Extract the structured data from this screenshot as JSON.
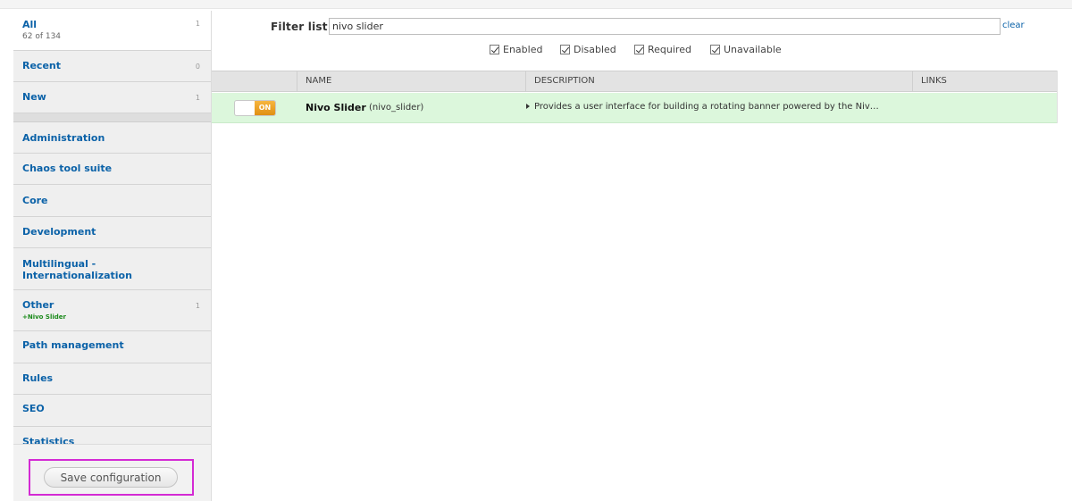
{
  "sidebar": {
    "categories": [
      {
        "label": "All",
        "count": "1",
        "sub": "62 of 134"
      },
      {
        "label": "Recent",
        "count": "0"
      },
      {
        "label": "New",
        "count": "1"
      },
      {
        "label": "Administration"
      },
      {
        "label": "Chaos tool suite"
      },
      {
        "label": "Core"
      },
      {
        "label": "Development"
      },
      {
        "label": "Multilingual -\nInternationalization"
      },
      {
        "label": "Other",
        "count": "1",
        "new_module": "+Nivo Slider"
      },
      {
        "label": "Path management"
      },
      {
        "label": "Rules"
      },
      {
        "label": "SEO"
      },
      {
        "label": "Statistics"
      }
    ],
    "save_label": "Save configuration"
  },
  "filter": {
    "label": "Filter list",
    "value": "nivo slider",
    "clear_label": "clear"
  },
  "checkboxes": [
    {
      "label": "Enabled",
      "checked": true
    },
    {
      "label": "Disabled",
      "checked": true
    },
    {
      "label": "Required",
      "checked": true
    },
    {
      "label": "Unavailable",
      "checked": true
    }
  ],
  "table": {
    "headers": [
      "NAME",
      "DESCRIPTION",
      "LINKS"
    ],
    "rows": [
      {
        "toggle_label": "ON",
        "name": "Nivo Slider",
        "machine_name": "(nivo_slider)",
        "description": "Provides a user interface for building a rotating banner powered by the Niv…",
        "links": ""
      }
    ]
  },
  "colors": {
    "link": "#0b62a8",
    "row_enabled_bg": "#dcf7dc",
    "toggle_on": "#e99d1f",
    "highlight_box": "#d42ad4",
    "new_module": "#1b8a1b"
  }
}
